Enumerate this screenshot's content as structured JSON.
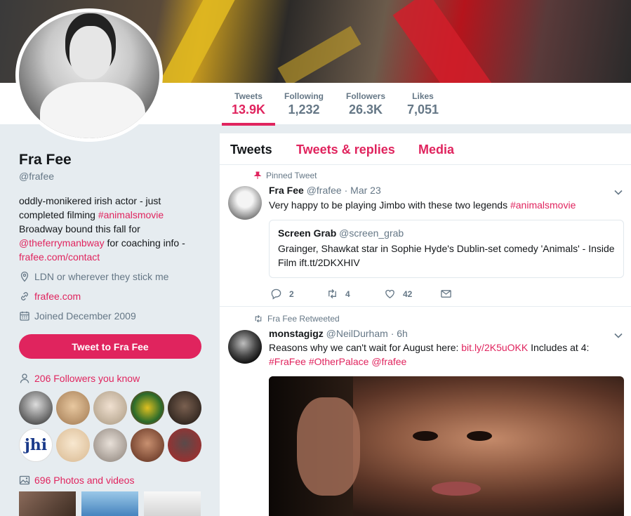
{
  "profile": {
    "name": "Fra Fee",
    "handle": "@frafee",
    "bio_1": "oddly-monikered irish actor - just completed filming ",
    "bio_tag": "#animalsmovie",
    "bio_2": " Broadway bound this fall for ",
    "bio_mention": "@theferrymanbway",
    "bio_3": " for coaching info - ",
    "bio_link": "frafee.com/contact",
    "location": "LDN or wherever they stick me",
    "website": "frafee.com",
    "joined": "Joined December 2009",
    "tweet_button": "Tweet to Fra Fee",
    "followers_you_know": "206 Followers you know",
    "photos_videos": "696 Photos and videos"
  },
  "stats": [
    {
      "label": "Tweets",
      "value": "13.9K"
    },
    {
      "label": "Following",
      "value": "1,232"
    },
    {
      "label": "Followers",
      "value": "26.3K"
    },
    {
      "label": "Likes",
      "value": "7,051"
    }
  ],
  "tabs": [
    "Tweets",
    "Tweets & replies",
    "Media"
  ],
  "pinned": {
    "context": "Pinned Tweet",
    "name": "Fra Fee",
    "handle": "@frafee",
    "time": "· Mar 23",
    "text_1": "Very happy to be playing Jimbo with these two legends ",
    "text_tag": "#animalsmovie",
    "card_name": "Screen Grab",
    "card_handle": "@screen_grab",
    "card_text": "Grainger, Shawkat star in Sophie Hyde's Dublin-set comedy 'Animals' - Inside Film ift.tt/2DKXHIV",
    "replies": "2",
    "retweets": "4",
    "likes": "42"
  },
  "retweet": {
    "context": "Fra Fee Retweeted",
    "name": "monstagigz",
    "handle": "@NeilDurham",
    "time": "· 6h",
    "text_1": "Reasons why we can't wait for August here: ",
    "text_link": "bit.ly/2K5uOKK",
    "text_2": " Includes at 4:",
    "tag1": "#FraFee",
    "tag2": "#OtherPalace",
    "tag3": "@frafee"
  },
  "colors": {
    "accent": "#e0245e",
    "text": "#14171a",
    "muted": "#657786"
  },
  "followers_avatars": [
    "#2a2a2a",
    "#c9a878",
    "#b8a890",
    "#3a7a2a",
    "#3a3430",
    "#1a3a8a",
    "#e8d0b0",
    "#c8c0b8",
    "#8a3a2a",
    "#b02828"
  ],
  "photo_thumbs": [
    "#6a4a3a",
    "#3a7ab8",
    "#f0f0f0"
  ]
}
